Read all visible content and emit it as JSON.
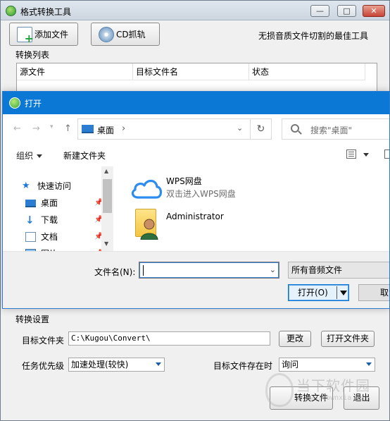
{
  "app": {
    "title": "格式转换工具",
    "add_file_label": "添加文件",
    "cd_grab_label": "CD抓轨",
    "slogan": "无损音质文件切割的最佳工具",
    "list_section": "转换列表",
    "columns": [
      "源文件",
      "目标文件名",
      "状态"
    ],
    "settings_section": "转换设置",
    "target_folder_label": "目标文件夹",
    "target_folder_value": "C:\\Kugou\\Convert\\",
    "change_label": "更改",
    "open_folder_label": "打开文件夹",
    "priority_label": "任务优先级",
    "priority_value": "加速处理(较快)",
    "exists_label": "目标文件存在时",
    "exists_value": "询问",
    "convert_label": "转换文件",
    "exit_label": "退出",
    "window_controls": {
      "minimize": "—",
      "maximize": "□",
      "close": "✕"
    }
  },
  "watermark": {
    "text": "当下软件园",
    "url": "www.downxia.com"
  },
  "dialog": {
    "title": "打开",
    "address": "桌面",
    "search_placeholder": "搜索\"桌面\"",
    "organize_label": "组织",
    "new_folder_label": "新建文件夹",
    "nav_items": [
      {
        "label": "快速访问",
        "icon": "star-icon"
      },
      {
        "label": "桌面",
        "icon": "desktop-icon"
      },
      {
        "label": "下载",
        "icon": "download-icon"
      },
      {
        "label": "文档",
        "icon": "document-icon"
      },
      {
        "label": "图片",
        "icon": "pictures-icon"
      }
    ],
    "files": [
      {
        "name": "WPS网盘",
        "subtitle": "双击进入WPS网盘",
        "icon": "cloud-icon"
      },
      {
        "name": "Administrator",
        "subtitle": "",
        "icon": "user-folder-icon"
      }
    ],
    "filename_label": "文件名(N):",
    "filename_value": "",
    "filetype_value": "所有音频文件",
    "open_label": "打开(O)",
    "cancel_label": "取消"
  },
  "colors": {
    "dialog_titlebar": "#0b78d6",
    "accent": "#1e78d5"
  }
}
